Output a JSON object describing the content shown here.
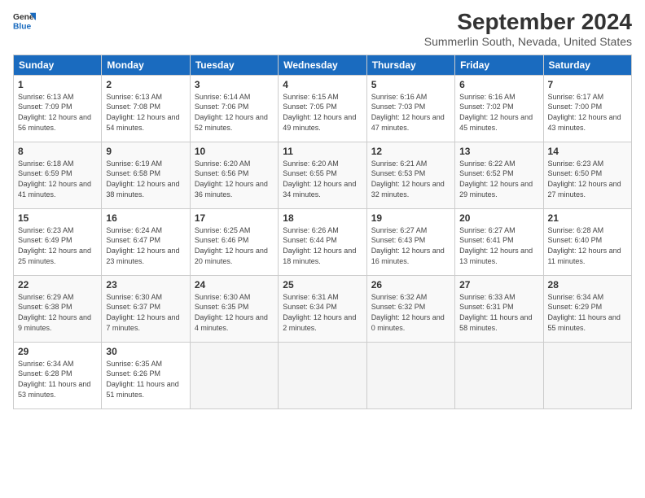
{
  "logo": {
    "line1": "General",
    "line2": "Blue"
  },
  "title": "September 2024",
  "subtitle": "Summerlin South, Nevada, United States",
  "headers": [
    "Sunday",
    "Monday",
    "Tuesday",
    "Wednesday",
    "Thursday",
    "Friday",
    "Saturday"
  ],
  "weeks": [
    [
      {
        "day": "1",
        "sunrise": "6:13 AM",
        "sunset": "7:09 PM",
        "daylight": "12 hours and 56 minutes."
      },
      {
        "day": "2",
        "sunrise": "6:13 AM",
        "sunset": "7:08 PM",
        "daylight": "12 hours and 54 minutes."
      },
      {
        "day": "3",
        "sunrise": "6:14 AM",
        "sunset": "7:06 PM",
        "daylight": "12 hours and 52 minutes."
      },
      {
        "day": "4",
        "sunrise": "6:15 AM",
        "sunset": "7:05 PM",
        "daylight": "12 hours and 49 minutes."
      },
      {
        "day": "5",
        "sunrise": "6:16 AM",
        "sunset": "7:03 PM",
        "daylight": "12 hours and 47 minutes."
      },
      {
        "day": "6",
        "sunrise": "6:16 AM",
        "sunset": "7:02 PM",
        "daylight": "12 hours and 45 minutes."
      },
      {
        "day": "7",
        "sunrise": "6:17 AM",
        "sunset": "7:00 PM",
        "daylight": "12 hours and 43 minutes."
      }
    ],
    [
      {
        "day": "8",
        "sunrise": "6:18 AM",
        "sunset": "6:59 PM",
        "daylight": "12 hours and 41 minutes."
      },
      {
        "day": "9",
        "sunrise": "6:19 AM",
        "sunset": "6:58 PM",
        "daylight": "12 hours and 38 minutes."
      },
      {
        "day": "10",
        "sunrise": "6:20 AM",
        "sunset": "6:56 PM",
        "daylight": "12 hours and 36 minutes."
      },
      {
        "day": "11",
        "sunrise": "6:20 AM",
        "sunset": "6:55 PM",
        "daylight": "12 hours and 34 minutes."
      },
      {
        "day": "12",
        "sunrise": "6:21 AM",
        "sunset": "6:53 PM",
        "daylight": "12 hours and 32 minutes."
      },
      {
        "day": "13",
        "sunrise": "6:22 AM",
        "sunset": "6:52 PM",
        "daylight": "12 hours and 29 minutes."
      },
      {
        "day": "14",
        "sunrise": "6:23 AM",
        "sunset": "6:50 PM",
        "daylight": "12 hours and 27 minutes."
      }
    ],
    [
      {
        "day": "15",
        "sunrise": "6:23 AM",
        "sunset": "6:49 PM",
        "daylight": "12 hours and 25 minutes."
      },
      {
        "day": "16",
        "sunrise": "6:24 AM",
        "sunset": "6:47 PM",
        "daylight": "12 hours and 23 minutes."
      },
      {
        "day": "17",
        "sunrise": "6:25 AM",
        "sunset": "6:46 PM",
        "daylight": "12 hours and 20 minutes."
      },
      {
        "day": "18",
        "sunrise": "6:26 AM",
        "sunset": "6:44 PM",
        "daylight": "12 hours and 18 minutes."
      },
      {
        "day": "19",
        "sunrise": "6:27 AM",
        "sunset": "6:43 PM",
        "daylight": "12 hours and 16 minutes."
      },
      {
        "day": "20",
        "sunrise": "6:27 AM",
        "sunset": "6:41 PM",
        "daylight": "12 hours and 13 minutes."
      },
      {
        "day": "21",
        "sunrise": "6:28 AM",
        "sunset": "6:40 PM",
        "daylight": "12 hours and 11 minutes."
      }
    ],
    [
      {
        "day": "22",
        "sunrise": "6:29 AM",
        "sunset": "6:38 PM",
        "daylight": "12 hours and 9 minutes."
      },
      {
        "day": "23",
        "sunrise": "6:30 AM",
        "sunset": "6:37 PM",
        "daylight": "12 hours and 7 minutes."
      },
      {
        "day": "24",
        "sunrise": "6:30 AM",
        "sunset": "6:35 PM",
        "daylight": "12 hours and 4 minutes."
      },
      {
        "day": "25",
        "sunrise": "6:31 AM",
        "sunset": "6:34 PM",
        "daylight": "12 hours and 2 minutes."
      },
      {
        "day": "26",
        "sunrise": "6:32 AM",
        "sunset": "6:32 PM",
        "daylight": "12 hours and 0 minutes."
      },
      {
        "day": "27",
        "sunrise": "6:33 AM",
        "sunset": "6:31 PM",
        "daylight": "11 hours and 58 minutes."
      },
      {
        "day": "28",
        "sunrise": "6:34 AM",
        "sunset": "6:29 PM",
        "daylight": "11 hours and 55 minutes."
      }
    ],
    [
      {
        "day": "29",
        "sunrise": "6:34 AM",
        "sunset": "6:28 PM",
        "daylight": "11 hours and 53 minutes."
      },
      {
        "day": "30",
        "sunrise": "6:35 AM",
        "sunset": "6:26 PM",
        "daylight": "11 hours and 51 minutes."
      },
      null,
      null,
      null,
      null,
      null
    ]
  ]
}
